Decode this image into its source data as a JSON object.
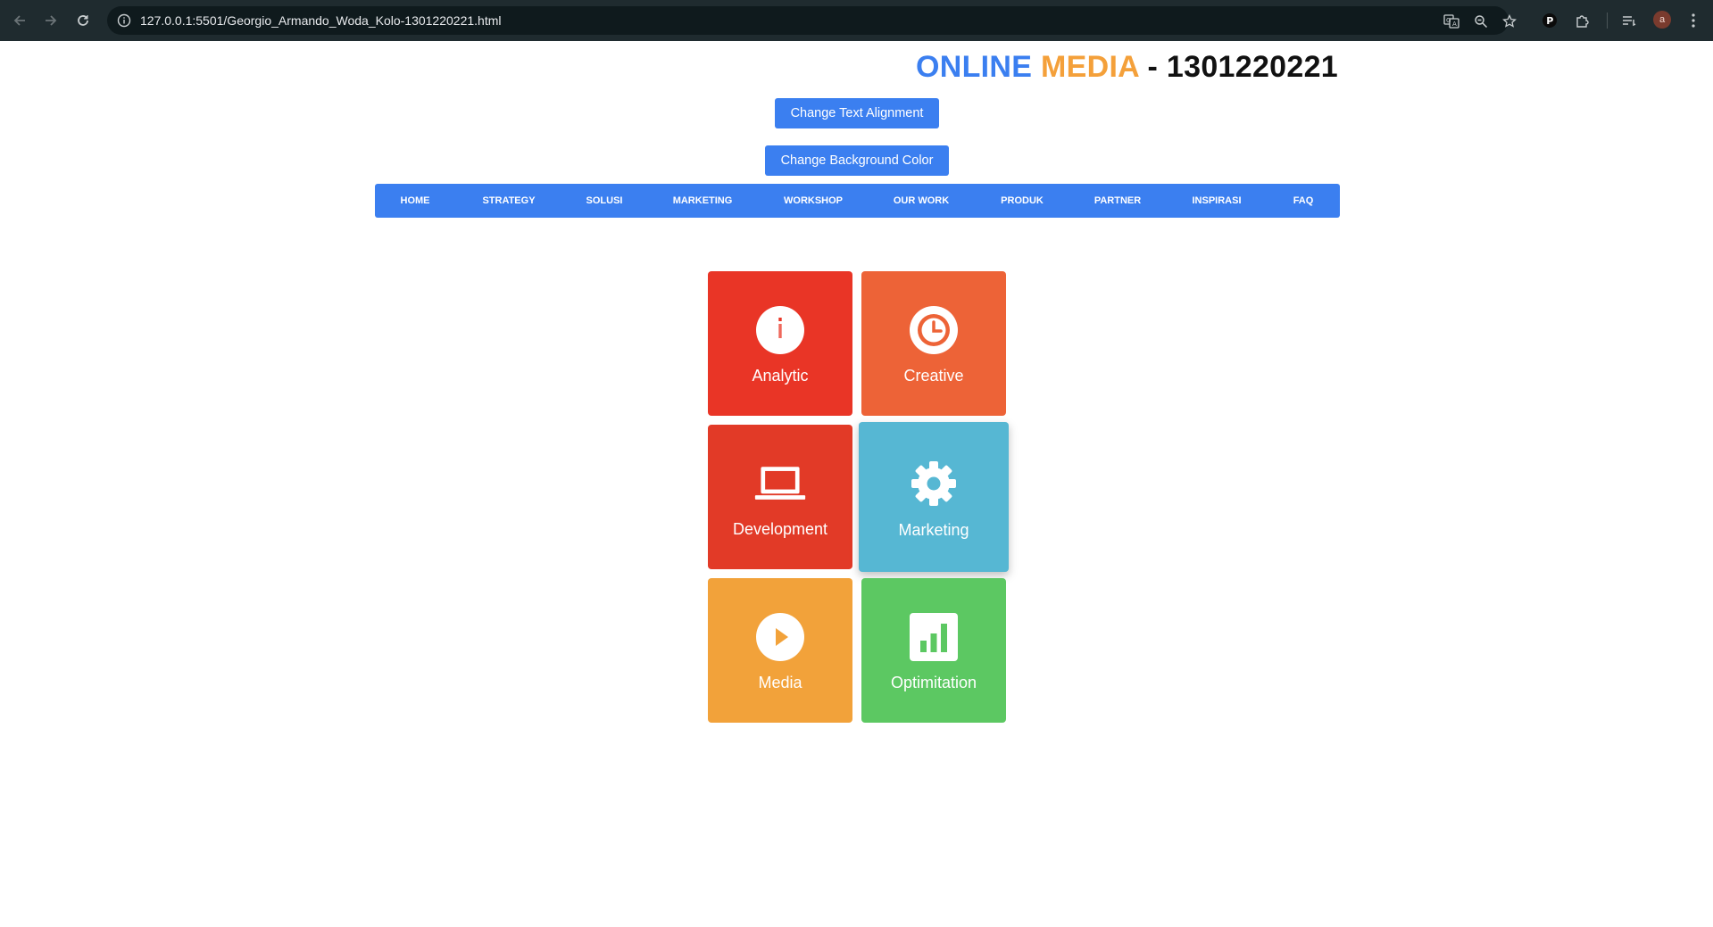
{
  "browser": {
    "url": "127.0.0.1:5501/Georgio_Armando_Woda_Kolo-1301220221.html",
    "profile_initial": "a"
  },
  "page": {
    "title_part1": "ONLINE",
    "title_part2": "MEDIA",
    "title_part3": "- 1301220221",
    "buttons": {
      "align_label": "Change Text Alignment",
      "bg_label": "Change Background Color"
    },
    "nav": [
      "HOME",
      "STRATEGY",
      "SOLUSI",
      "MARKETING",
      "WORKSHOP",
      "OUR WORK",
      "PRODUK",
      "PARTNER",
      "INSPIRASI",
      "FAQ"
    ],
    "tiles": [
      {
        "label": "Analytic",
        "icon": "info-icon",
        "color": "#e93526"
      },
      {
        "label": "Creative",
        "icon": "clock-icon",
        "color": "#ed6337"
      },
      {
        "label": "Development",
        "icon": "laptop-icon",
        "color": "#e23a27"
      },
      {
        "label": "Marketing",
        "icon": "gear-icon",
        "color": "#56b7d3"
      },
      {
        "label": "Media",
        "icon": "play-icon",
        "color": "#f2a23a"
      },
      {
        "label": "Optimitation",
        "icon": "bar-chart-icon",
        "color": "#5cc862"
      }
    ]
  },
  "colors": {
    "accent": "#3b7ff0",
    "title_orange": "#f4a03a",
    "chrome_bg": "#1f2b2f"
  }
}
